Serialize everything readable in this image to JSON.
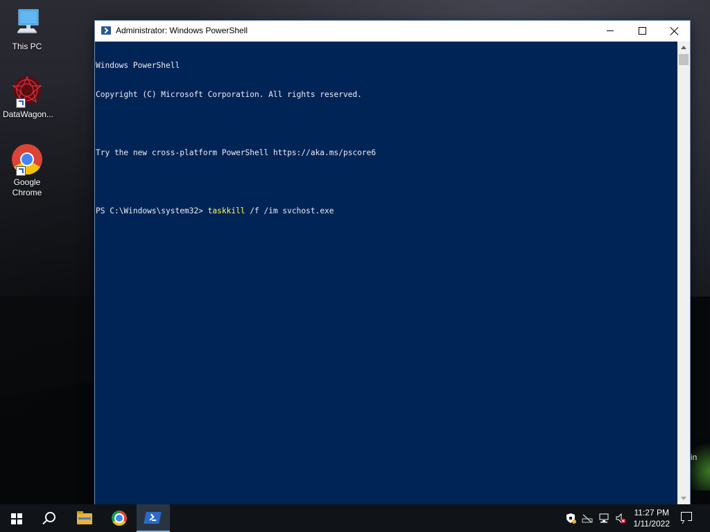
{
  "desktop": {
    "icons": [
      {
        "label": "This PC",
        "icon": "computer-icon"
      },
      {
        "label": "DataWagon...",
        "icon": "datawagon-icon"
      },
      {
        "label": "Google Chrome",
        "icon": "chrome-icon"
      }
    ],
    "partial_text": "in"
  },
  "window": {
    "title": "Administrator: Windows PowerShell",
    "icon": "powershell-icon",
    "console_bg": "#012456",
    "console": {
      "line1": "Windows PowerShell",
      "line2": "Copyright (C) Microsoft Corporation. All rights reserved.",
      "line3": "Try the new cross-platform PowerShell https://aka.ms/pscore6",
      "prompt": "PS C:\\Windows\\system32> ",
      "command": "taskkill",
      "args": " /f /im svchost.exe"
    }
  },
  "taskbar": {
    "items": [
      "start-icon",
      "search-icon",
      "file-explorer-icon",
      "chrome-icon",
      "powershell-icon"
    ],
    "active": "powershell-icon",
    "tray": [
      "security-icon",
      "network-disabled-icon",
      "network-icon",
      "volume-muted-icon"
    ],
    "time": "11:27 PM",
    "date": "1/11/2022"
  }
}
